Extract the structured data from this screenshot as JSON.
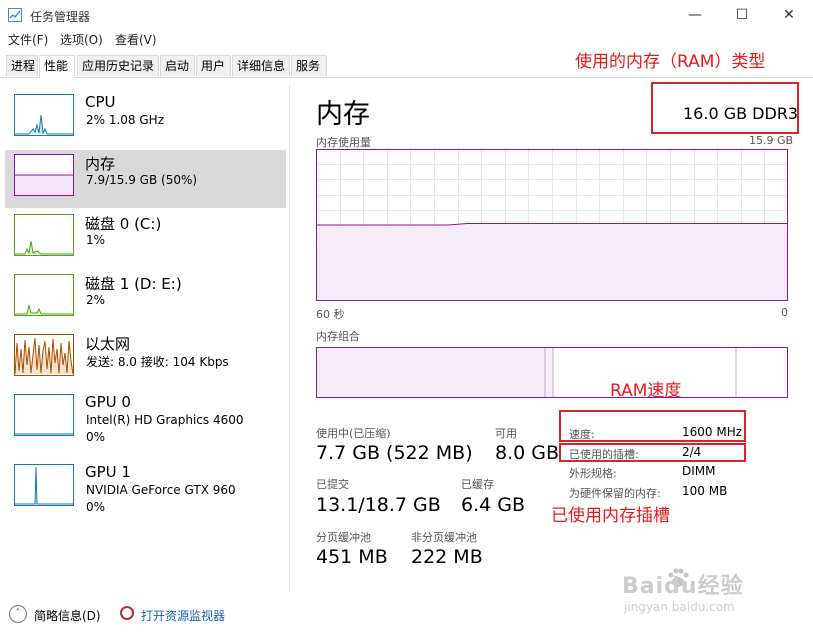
{
  "window": {
    "title": "任务管理器",
    "controls": [
      "—",
      "☐",
      "✕"
    ]
  },
  "menu": [
    "文件(F)",
    "选项(O)",
    "查看(V)"
  ],
  "tabs": [
    "进程",
    "性能",
    "应用历史记录",
    "启动",
    "用户",
    "详细信息",
    "服务"
  ],
  "active_tab": "性能",
  "sidebar": {
    "items": [
      {
        "name": "CPU",
        "line1": "2%  1.08 GHz",
        "line2": "",
        "color": "#1779ba"
      },
      {
        "name": "内存",
        "line1": "7.9/15.9 GB (50%)",
        "line2": "",
        "color": "#8b12ae"
      },
      {
        "name": "磁盘 0 (C:)",
        "line1": "1%",
        "line2": "",
        "color": "#4da60c"
      },
      {
        "name": "磁盘 1 (D: E:)",
        "line1": "2%",
        "line2": "",
        "color": "#4da60c"
      },
      {
        "name": "以太网",
        "line1": "发送: 8.0  接收: 104 Kbps",
        "line2": "",
        "color": "#a74f01"
      },
      {
        "name": "GPU 0",
        "line1": "Intel(R) HD Graphics 4600",
        "line2": "0%",
        "color": "#1779ba"
      },
      {
        "name": "GPU 1",
        "line1": "NVIDIA GeForce GTX 960",
        "line2": "0%",
        "color": "#1779ba"
      }
    ]
  },
  "main": {
    "heading": "内存",
    "ram_type": "16.0 GB DDR3",
    "graph_label": "内存使用量",
    "graph_max": "15.9 GB",
    "graph_time_left": "60 秒",
    "graph_time_right": "0",
    "composition_label": "内存组合",
    "usage_fraction": 0.5,
    "stats": {
      "in_use_label": "使用中(已压缩)",
      "in_use_value": "7.7 GB (522 MB)",
      "available_label": "可用",
      "available_value": "8.0 GB",
      "committed_label": "已提交",
      "committed_value": "13.1/18.7 GB",
      "cached_label": "已缓存",
      "cached_value": "6.4 GB",
      "paged_label": "分页缓冲池",
      "paged_value": "451 MB",
      "nonpaged_label": "非分页缓冲池",
      "nonpaged_value": "222 MB"
    },
    "details": [
      {
        "label": "速度:",
        "value": "1600 MHz"
      },
      {
        "label": "已使用的插槽:",
        "value": "2/4"
      },
      {
        "label": "外形规格:",
        "value": "DIMM"
      },
      {
        "label": "为硬件保留的内存:",
        "value": "100 MB"
      }
    ]
  },
  "annotations": {
    "ram_type": "使用的内存（RAM）类型",
    "ram_speed": "RAM速度",
    "slots_used": "已使用内存插槽"
  },
  "status": {
    "summary": "简略信息(D)",
    "monitor": "打开资源监视器"
  },
  "watermark": {
    "brand": "Baidu经验",
    "url": "jingyan.baidu.com"
  },
  "colors": {
    "memory": "#8b12ae",
    "annotation": "#e8191e"
  }
}
